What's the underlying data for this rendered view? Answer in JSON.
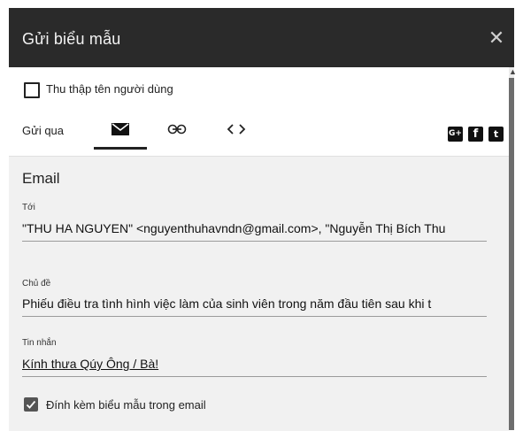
{
  "dialog": {
    "title": "Gửi biểu mẫu",
    "close_icon": "close-icon",
    "collect_username_label": "Thu thập tên người dùng",
    "send_via_label": "Gửi qua",
    "tabs": [
      {
        "icon": "email-icon",
        "active": true
      },
      {
        "icon": "link-icon",
        "active": false
      },
      {
        "icon": "embed-code-icon",
        "active": false
      }
    ],
    "share_icons": [
      "google-plus-icon",
      "facebook-icon",
      "twitter-icon"
    ],
    "share_glyphs": {
      "google_plus": "G+",
      "facebook": "f",
      "twitter": "t"
    }
  },
  "email": {
    "heading": "Email",
    "to_label": "Tới",
    "to_value": "\"THU HA NGUYEN\" <nguyenthuhavndn@gmail.com>, \"Nguyễn Thị Bích Thu",
    "subject_label": "Chủ đề",
    "subject_value": "Phiếu điều tra tình hình việc làm của sinh viên  trong năm đầu tiên sau khi t",
    "message_label": "Tin nhắn",
    "message_value": "Kính thưa Qúy Ông / Bà!",
    "attach_label": "Đính kèm biểu mẫu trong email",
    "attach_checked": true
  }
}
